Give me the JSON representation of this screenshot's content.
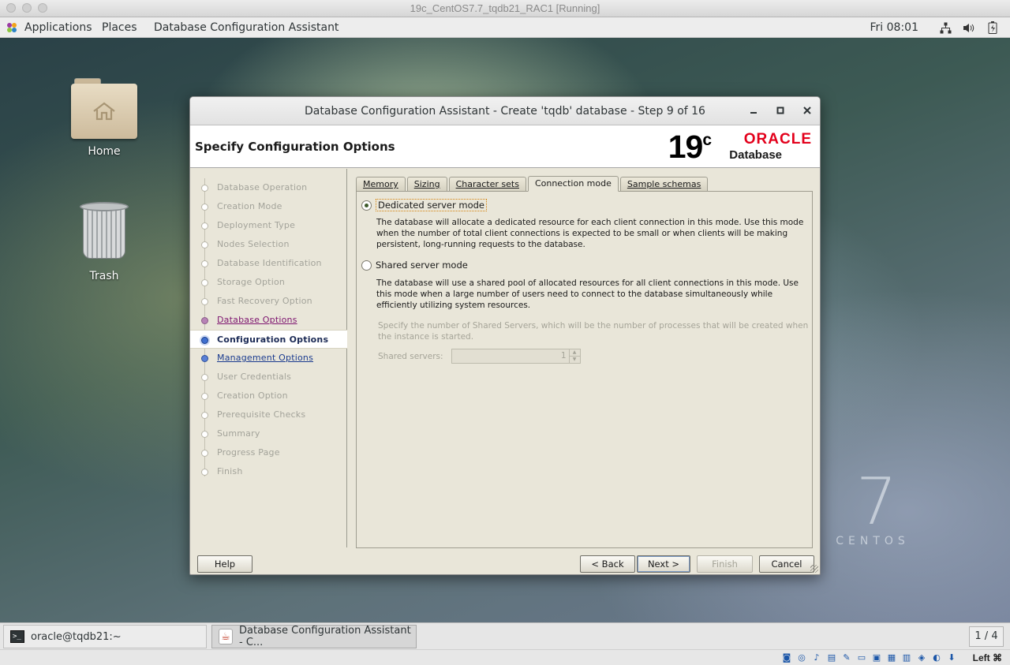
{
  "vm_window": {
    "title": "19c_CentOS7.7_tqdb21_RAC1 [Running]"
  },
  "topbar": {
    "applications": "Applications",
    "places": "Places",
    "active_app": "Database Configuration Assistant",
    "clock": "Fri 08:01",
    "tray_icons": [
      "network-icon",
      "volume-icon",
      "battery-icon"
    ]
  },
  "desktop": {
    "icons": [
      {
        "label": "Home",
        "icon": "home-folder-icon"
      },
      {
        "label": "Trash",
        "icon": "trash-icon"
      }
    ],
    "wallpaper": {
      "numeral": "7",
      "word": "CENTOS"
    }
  },
  "dialog": {
    "title": "Database Configuration Assistant - Create 'tqdb' database - Step 9 of 16",
    "header": "Specify Configuration Options",
    "logo": {
      "version": "19",
      "version_suffix": "c",
      "brand": "ORACLE",
      "product": "Database"
    },
    "steps": [
      {
        "label": "Database Operation",
        "state": "disabled"
      },
      {
        "label": "Creation Mode",
        "state": "disabled"
      },
      {
        "label": "Deployment Type",
        "state": "disabled"
      },
      {
        "label": "Nodes Selection",
        "state": "disabled"
      },
      {
        "label": "Database Identification",
        "state": "disabled"
      },
      {
        "label": "Storage Option",
        "state": "disabled"
      },
      {
        "label": "Fast Recovery Option",
        "state": "disabled"
      },
      {
        "label": "Database Options",
        "state": "visited"
      },
      {
        "label": "Configuration Options",
        "state": "active"
      },
      {
        "label": "Management Options",
        "state": "link"
      },
      {
        "label": "User Credentials",
        "state": "disabled"
      },
      {
        "label": "Creation Option",
        "state": "disabled"
      },
      {
        "label": "Prerequisite Checks",
        "state": "disabled"
      },
      {
        "label": "Summary",
        "state": "disabled"
      },
      {
        "label": "Progress Page",
        "state": "disabled"
      },
      {
        "label": "Finish",
        "state": "disabled"
      }
    ],
    "tabs": [
      {
        "label": "Memory",
        "selected": false
      },
      {
        "label": "Sizing",
        "selected": false
      },
      {
        "label": "Character sets",
        "selected": false
      },
      {
        "label": "Connection mode",
        "selected": true
      },
      {
        "label": "Sample schemas",
        "selected": false
      }
    ],
    "connection_mode": {
      "dedicated_label": "Dedicated server mode",
      "dedicated_desc": "The database will allocate a dedicated resource for each client connection in this mode. Use this mode when the number of total client connections is expected to be small or when clients will be making persistent, long-running requests to the database.",
      "shared_label": "Shared server mode",
      "shared_desc": "The database will use a shared pool of allocated resources for all client connections in this mode.  Use this mode when a large number of users need to connect to the database simultaneously while efficiently utilizing system resources.",
      "shared_servers_desc": "Specify the number of Shared Servers, which will be the number of processes that will be created when the instance is started.",
      "shared_servers_label": "Shared servers:",
      "shared_servers_value": "1",
      "selected": "dedicated"
    },
    "buttons": {
      "help": "Help",
      "back": "< Back",
      "next": "Next >",
      "finish": "Finish",
      "cancel": "Cancel"
    }
  },
  "taskbar": {
    "tasks": [
      {
        "label": "oracle@tqdb21:~",
        "icon": "terminal-icon"
      },
      {
        "label": "Database Configuration Assistant - C...",
        "icon": "java-icon"
      }
    ],
    "pager": "1 / 4"
  },
  "vb_status": {
    "host_key": "Left ⌘"
  }
}
